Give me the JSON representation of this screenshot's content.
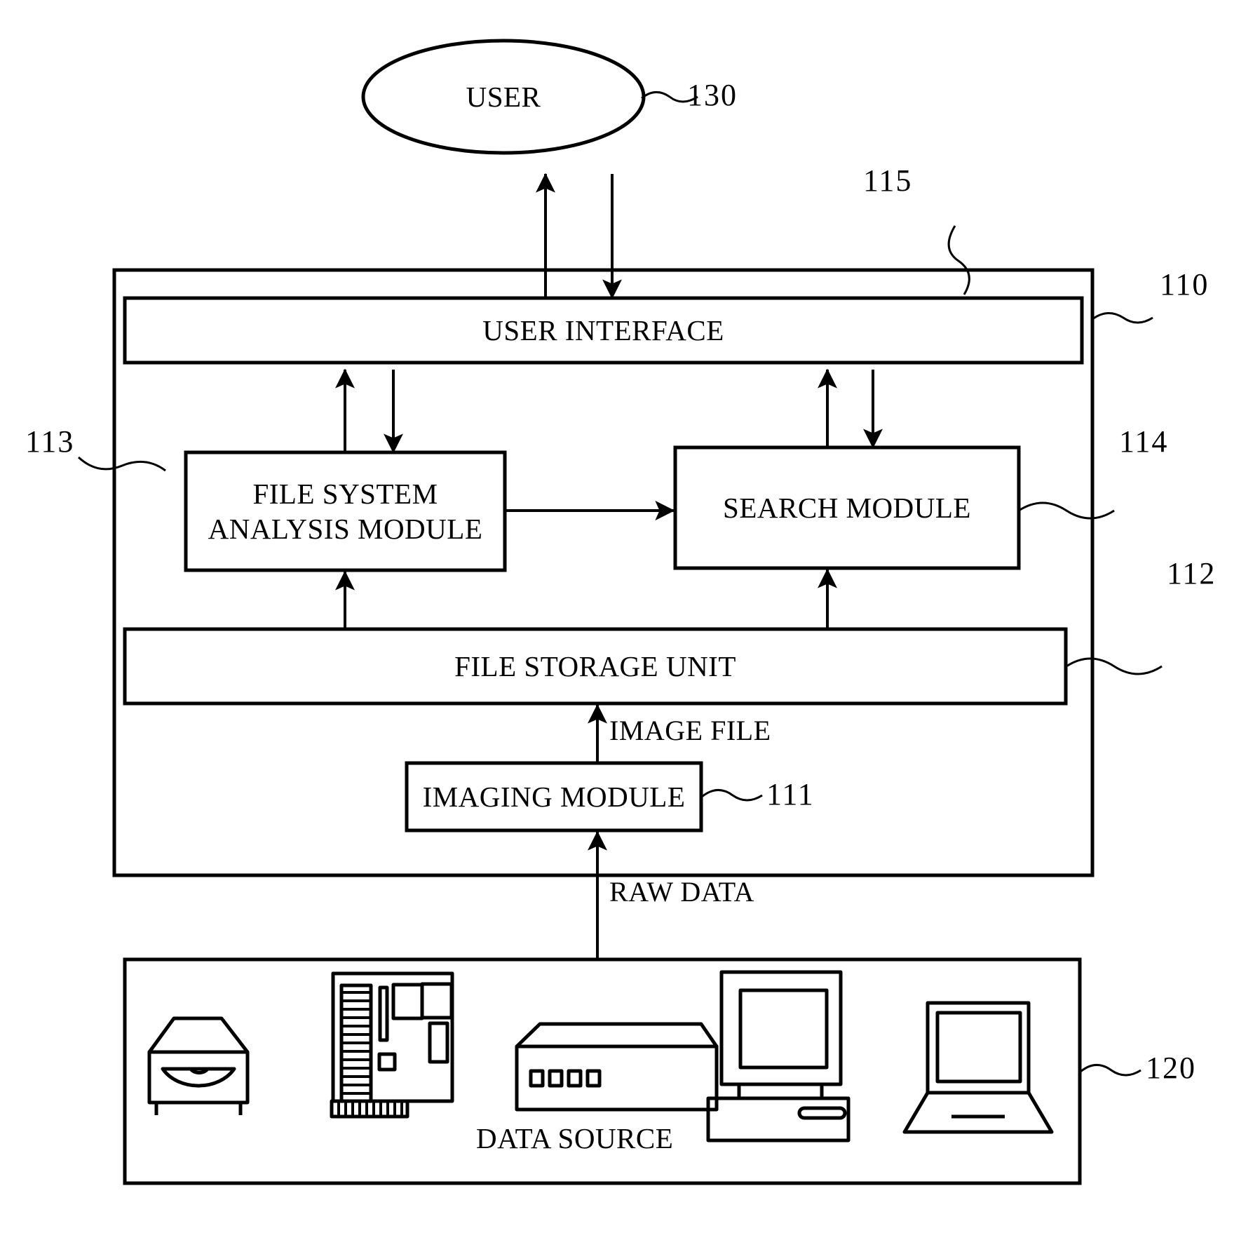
{
  "figure": {
    "type": "patent-block-diagram",
    "background": "#ffffff",
    "line_color": "#000000"
  },
  "nodes": {
    "user": {
      "label": "USER",
      "ref": "130",
      "shape": "ellipse"
    },
    "system": {
      "ref": "110",
      "shape": "rect-container"
    },
    "system_inner": {
      "ref": "115",
      "shape": "rect-container"
    },
    "user_interface": {
      "label": "USER INTERFACE",
      "shape": "rect"
    },
    "file_system_analysis_module": {
      "label_line1": "FILE SYSTEM",
      "label_line2": "ANALYSIS MODULE",
      "ref": "113",
      "shape": "rect"
    },
    "search_module": {
      "label": "SEARCH MODULE",
      "ref": "114",
      "shape": "rect"
    },
    "file_storage_unit": {
      "label": "FILE STORAGE UNIT",
      "ref": "112",
      "shape": "rect"
    },
    "imaging_module": {
      "label": "IMAGING MODULE",
      "ref": "111",
      "shape": "rect"
    },
    "data_source": {
      "label": "DATA SOURCE",
      "ref": "120",
      "shape": "rect-container"
    }
  },
  "edge_labels": {
    "image_file": "IMAGE FILE",
    "raw_data": "RAW DATA"
  },
  "data_source_icons": [
    {
      "name": "optical-disc-drive-icon"
    },
    {
      "name": "expansion-card-icon"
    },
    {
      "name": "server-box-icon"
    },
    {
      "name": "desktop-computer-icon"
    },
    {
      "name": "laptop-computer-icon"
    }
  ],
  "reference_numerals": [
    "130",
    "115",
    "110",
    "113",
    "114",
    "112",
    "111",
    "120"
  ]
}
